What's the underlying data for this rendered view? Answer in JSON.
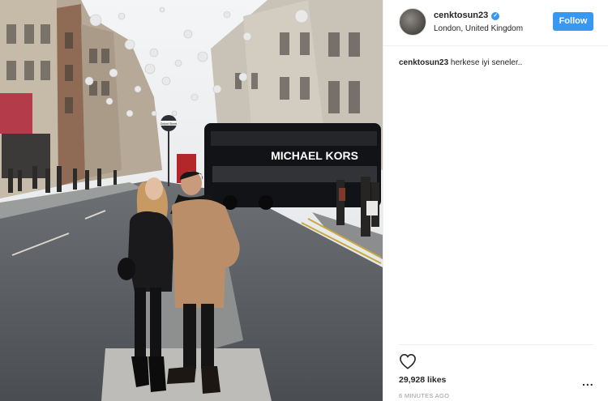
{
  "post": {
    "username": "cenktosun23",
    "location": "London, United Kingdom",
    "follow_label": "Follow",
    "caption_user": "cenktosun23",
    "caption_text": "herkese iyi seneler..",
    "likes": "29,928 likes",
    "timestamp": "6 MINUTES AGO",
    "more_label": "..."
  },
  "photo": {
    "bus_text": "MICHAEL KORS",
    "sign_text": "Oxford Street",
    "alt": "Couple posing on Oxford Street in London with a Michael Kors double-decker bus"
  },
  "icons": {
    "verified": "verified-badge-icon",
    "heart": "heart-icon",
    "more": "more-options-icon"
  },
  "colors": {
    "accent": "#3897f0",
    "text": "#262626",
    "muted": "#999999",
    "border": "#efefef"
  }
}
